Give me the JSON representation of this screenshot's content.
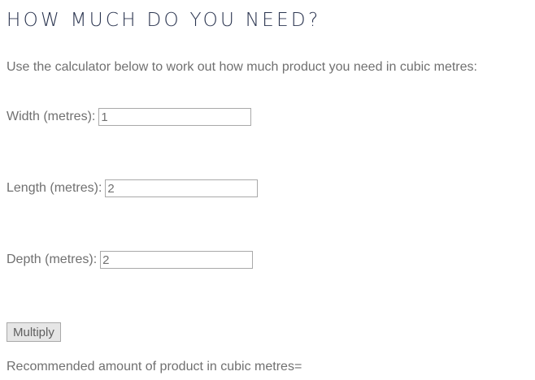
{
  "heading": "HOW MUCH DO YOU NEED?",
  "intro": "Use the calculator below to work out how much product you need in cubic metres:",
  "fields": {
    "width": {
      "label": "Width (metres):",
      "value": "1"
    },
    "length": {
      "label": "Length (metres):",
      "value": "2"
    },
    "depth": {
      "label": "Depth (metres):",
      "value": "2"
    }
  },
  "button_label": "Multiply",
  "result_text": "Recommended amount of product in cubic metres="
}
